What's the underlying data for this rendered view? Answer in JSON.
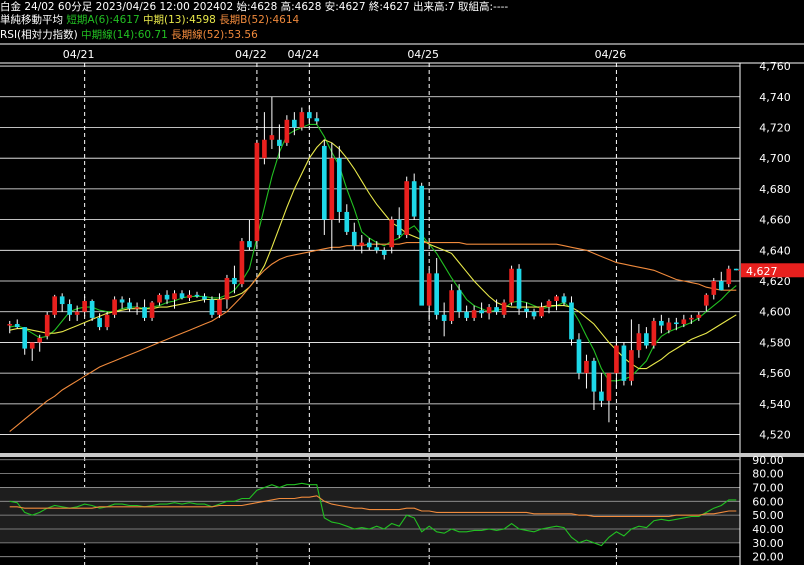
{
  "header": {
    "instrument": "白金 24/02 60分足 2023/04/26 12:00 202402",
    "open": "始:4628",
    "high": "高:4628",
    "low": "安:4627",
    "close": "終:4627",
    "volume": "出来高:7",
    "oi": "取組高:----",
    "ma_title": "単純移動平均",
    "ma_short": "短期A(6):4617",
    "ma_mid": "中期(13):4598",
    "ma_long": "長期B(52):4614",
    "rsi_title": "RSI(相対力指数)",
    "rsi_mid": "中期線(14):60.71",
    "rsi_long": "長期線(52):53.56"
  },
  "colors": {
    "up": "#e8201e",
    "down": "#1ed8e8",
    "ma_short": "#22c022",
    "ma_mid": "#e8e84a",
    "ma_long": "#f08a3c",
    "grid": "#ffffff",
    "price_tag": "#e8201e"
  },
  "chart_data": [
    {
      "type": "candlestick",
      "x_labels": [
        "04/21",
        "04/22",
        "04/24",
        "04/25",
        "04/26"
      ],
      "ylim": [
        4508,
        4762
      ],
      "y_ticks": [
        4520,
        4540,
        4560,
        4580,
        4600,
        4620,
        4640,
        4660,
        4680,
        4700,
        4720,
        4740,
        4760
      ],
      "y_tick_labels": [
        "4,520",
        "4,540",
        "4,560",
        "4,580",
        "4,600",
        "4,620",
        "4,640",
        "4,660",
        "4,680",
        "4,700",
        "4,720",
        "4,740",
        "4,760"
      ],
      "last_price": 4627,
      "last_price_label": "4,627",
      "candles": [
        [
          4591,
          4594,
          4586,
          4592
        ],
        [
          4592,
          4595,
          4589,
          4590
        ],
        [
          4590,
          4590,
          4572,
          4576
        ],
        [
          4576,
          4580,
          4568,
          4580
        ],
        [
          4580,
          4585,
          4574,
          4583
        ],
        [
          4584,
          4600,
          4582,
          4598
        ],
        [
          4598,
          4611,
          4596,
          4610
        ],
        [
          4610,
          4612,
          4600,
          4605
        ],
        [
          4605,
          4608,
          4594,
          4598
        ],
        [
          4598,
          4604,
          4594,
          4600
        ],
        [
          4600,
          4610,
          4597,
          4607
        ],
        [
          4607,
          4608,
          4594,
          4596
        ],
        [
          4596,
          4599,
          4588,
          4590
        ],
        [
          4590,
          4600,
          4588,
          4598
        ],
        [
          4598,
          4610,
          4596,
          4608
        ],
        [
          4608,
          4610,
          4602,
          4606
        ],
        [
          4606,
          4609,
          4600,
          4602
        ],
        [
          4602,
          4606,
          4598,
          4603
        ],
        [
          4603,
          4608,
          4594,
          4596
        ],
        [
          4596,
          4607,
          4594,
          4606
        ],
        [
          4606,
          4612,
          4604,
          4611
        ],
        [
          4611,
          4614,
          4605,
          4608
        ],
        [
          4608,
          4614,
          4602,
          4612
        ],
        [
          4612,
          4614,
          4608,
          4609
        ],
        [
          4609,
          4614,
          4607,
          4611
        ],
        [
          4611,
          4613,
          4609,
          4610
        ],
        [
          4610,
          4612,
          4606,
          4608
        ],
        [
          4608,
          4610,
          4596,
          4598
        ],
        [
          4598,
          4612,
          4596,
          4608
        ],
        [
          4608,
          4624,
          4602,
          4622
        ],
        [
          4622,
          4630,
          4612,
          4618
        ],
        [
          4618,
          4648,
          4616,
          4646
        ],
        [
          4646,
          4660,
          4640,
          4642
        ],
        [
          4646,
          4712,
          4642,
          4710
        ],
        [
          4700,
          4730,
          4696,
          4712
        ],
        [
          4712,
          4740,
          4706,
          4715
        ],
        [
          4712,
          4722,
          4700,
          4708
        ],
        [
          4710,
          4728,
          4708,
          4725
        ],
        [
          4725,
          4730,
          4715,
          4720
        ],
        [
          4720,
          4733,
          4718,
          4730
        ],
        [
          4730,
          4734,
          4722,
          4726
        ],
        [
          4726,
          4730,
          4722,
          4724
        ],
        [
          4708,
          4712,
          4650,
          4660
        ],
        [
          4660,
          4710,
          4640,
          4700
        ],
        [
          4700,
          4708,
          4658,
          4665
        ],
        [
          4665,
          4670,
          4650,
          4652
        ],
        [
          4652,
          4658,
          4640,
          4643
        ],
        [
          4643,
          4650,
          4638,
          4645
        ],
        [
          4645,
          4648,
          4640,
          4642
        ],
        [
          4642,
          4646,
          4638,
          4640
        ],
        [
          4640,
          4642,
          4634,
          4637
        ],
        [
          4642,
          4662,
          4638,
          4660
        ],
        [
          4660,
          4668,
          4648,
          4650
        ],
        [
          4650,
          4688,
          4648,
          4685
        ],
        [
          4685,
          4690,
          4660,
          4662
        ],
        [
          4682,
          4684,
          4640,
          4604
        ],
        [
          4604,
          4628,
          4594,
          4625
        ],
        [
          4625,
          4635,
          4595,
          4598
        ],
        [
          4598,
          4606,
          4584,
          4594
        ],
        [
          4594,
          4618,
          4592,
          4614
        ],
        [
          4614,
          4618,
          4596,
          4600
        ],
        [
          4600,
          4604,
          4594,
          4596
        ],
        [
          4596,
          4604,
          4594,
          4601
        ],
        [
          4601,
          4606,
          4596,
          4599
        ],
        [
          4599,
          4605,
          4595,
          4603
        ],
        [
          4603,
          4608,
          4598,
          4600
        ],
        [
          4598,
          4608,
          4596,
          4606
        ],
        [
          4606,
          4630,
          4604,
          4628
        ],
        [
          4628,
          4631,
          4598,
          4602
        ],
        [
          4602,
          4606,
          4596,
          4600
        ],
        [
          4600,
          4602,
          4595,
          4597
        ],
        [
          4597,
          4606,
          4596,
          4603
        ],
        [
          4603,
          4608,
          4599,
          4607
        ],
        [
          4607,
          4611,
          4601,
          4610
        ],
        [
          4610,
          4612,
          4604,
          4606
        ],
        [
          4606,
          4610,
          4578,
          4582
        ],
        [
          4582,
          4586,
          4556,
          4560
        ],
        [
          4560,
          4572,
          4550,
          4568
        ],
        [
          4568,
          4570,
          4536,
          4548
        ],
        [
          4548,
          4560,
          4538,
          4542
        ],
        [
          4542,
          4554,
          4528,
          4560
        ],
        [
          4560,
          4582,
          4550,
          4578
        ],
        [
          4578,
          4580,
          4552,
          4555
        ],
        [
          4555,
          4595,
          4552,
          4575
        ],
        [
          4575,
          4592,
          4570,
          4586
        ],
        [
          4586,
          4590,
          4576,
          4578
        ],
        [
          4578,
          4596,
          4576,
          4594
        ],
        [
          4594,
          4598,
          4586,
          4591
        ],
        [
          4588,
          4596,
          4586,
          4593
        ],
        [
          4593,
          4596,
          4588,
          4592
        ],
        [
          4592,
          4598,
          4590,
          4595
        ],
        [
          4595,
          4598,
          4592,
          4596
        ],
        [
          4596,
          4600,
          4594,
          4598
        ],
        [
          4604,
          4612,
          4600,
          4611
        ],
        [
          4611,
          4622,
          4608,
          4620
        ],
        [
          4620,
          4626,
          4614,
          4614
        ],
        [
          4618,
          4630,
          4616,
          4628
        ],
        [
          4628,
          4628,
          4627,
          4627
        ]
      ],
      "series": [
        {
          "name": "短期A(6)",
          "color": "#22c022",
          "values": [
            4590,
            4591,
            4589,
            4586,
            4583,
            4584,
            4588,
            4594,
            4600,
            4602,
            4603,
            4603,
            4601,
            4600,
            4600,
            4602,
            4603,
            4603,
            4602,
            4603,
            4604,
            4606,
            4607,
            4609,
            4610,
            4610,
            4610,
            4609,
            4609,
            4611,
            4614,
            4620,
            4628,
            4648,
            4668,
            4688,
            4704,
            4715,
            4718,
            4720,
            4722,
            4722,
            4714,
            4704,
            4695,
            4680,
            4667,
            4652,
            4648,
            4645,
            4643,
            4646,
            4648,
            4653,
            4656,
            4650,
            4644,
            4638,
            4630,
            4622,
            4615,
            4608,
            4604,
            4602,
            4600,
            4601,
            4602,
            4606,
            4607,
            4606,
            4604,
            4602,
            4603,
            4604,
            4606,
            4602,
            4594,
            4584,
            4575,
            4563,
            4555,
            4555,
            4556,
            4558,
            4563,
            4568,
            4578,
            4584,
            4587,
            4589,
            4591,
            4593,
            4596,
            4600,
            4604,
            4608,
            4613,
            4617
          ]
        },
        {
          "name": "中期(13)",
          "color": "#e8e84a",
          "values": [
            4588,
            4589,
            4589,
            4588,
            4587,
            4586,
            4586,
            4587,
            4589,
            4591,
            4593,
            4595,
            4597,
            4599,
            4600,
            4601,
            4602,
            4602,
            4602,
            4602,
            4603,
            4603,
            4604,
            4605,
            4606,
            4607,
            4608,
            4608,
            4608,
            4609,
            4610,
            4612,
            4616,
            4622,
            4630,
            4642,
            4655,
            4668,
            4680,
            4690,
            4700,
            4707,
            4712,
            4710,
            4706,
            4700,
            4693,
            4685,
            4677,
            4670,
            4664,
            4658,
            4655,
            4651,
            4649,
            4647,
            4644,
            4642,
            4640,
            4638,
            4632,
            4626,
            4620,
            4615,
            4610,
            4606,
            4604,
            4603,
            4603,
            4603,
            4603,
            4603,
            4604,
            4604,
            4604,
            4603,
            4600,
            4596,
            4592,
            4586,
            4580,
            4575,
            4570,
            4566,
            4563,
            4563,
            4566,
            4569,
            4573,
            4576,
            4579,
            4582,
            4584,
            4586,
            4589,
            4592,
            4595,
            4598
          ]
        },
        {
          "name": "長期B(52)",
          "color": "#f08a3c",
          "values": [
            4522,
            4526,
            4530,
            4534,
            4538,
            4542,
            4545,
            4549,
            4552,
            4555,
            4558,
            4561,
            4564,
            4566,
            4568,
            4570,
            4572,
            4574,
            4576,
            4578,
            4580,
            4582,
            4584,
            4586,
            4588,
            4590,
            4592,
            4594,
            4597,
            4600,
            4605,
            4610,
            4616,
            4622,
            4627,
            4631,
            4634,
            4636,
            4637,
            4638,
            4639,
            4640,
            4641,
            4642,
            4642,
            4643,
            4643,
            4643,
            4644,
            4644,
            4644,
            4644,
            4644,
            4645,
            4645,
            4645,
            4645,
            4645,
            4645,
            4645,
            4645,
            4644,
            4644,
            4644,
            4644,
            4644,
            4644,
            4644,
            4644,
            4644,
            4644,
            4644,
            4644,
            4644,
            4643,
            4642,
            4641,
            4640,
            4638,
            4636,
            4634,
            4632,
            4631,
            4630,
            4629,
            4628,
            4627,
            4625,
            4623,
            4621,
            4620,
            4619,
            4618,
            4616,
            4615,
            4614,
            4614,
            4614
          ]
        }
      ]
    },
    {
      "type": "line",
      "title": "RSI(相対力指数)",
      "ylim": [
        14,
        92
      ],
      "y_ticks": [
        20,
        30,
        40,
        50,
        60,
        70,
        80,
        90
      ],
      "y_tick_labels": [
        "20.00",
        "30.00",
        "40.00",
        "50.00",
        "60.00",
        "70.00",
        "80.00",
        "90.00"
      ],
      "series": [
        {
          "name": "中期線(14)",
          "color": "#22c022",
          "values": [
            60,
            59,
            52,
            50,
            52,
            55,
            57,
            56,
            55,
            56,
            58,
            57,
            55,
            56,
            58,
            58,
            57,
            57,
            56,
            57,
            58,
            58,
            59,
            58,
            59,
            58,
            58,
            56,
            58,
            60,
            60,
            62,
            62,
            68,
            70,
            72,
            70,
            72,
            72,
            73,
            72,
            72,
            48,
            45,
            44,
            42,
            40,
            41,
            40,
            42,
            40,
            44,
            42,
            50,
            48,
            38,
            42,
            38,
            37,
            40,
            38,
            38,
            39,
            39,
            40,
            39,
            40,
            44,
            40,
            39,
            38,
            40,
            41,
            42,
            41,
            34,
            30,
            32,
            30,
            28,
            34,
            38,
            35,
            40,
            42,
            41,
            46,
            47,
            46,
            47,
            48,
            49,
            49,
            52,
            55,
            57,
            61,
            61
          ]
        },
        {
          "name": "長期線(52)",
          "color": "#f08a3c",
          "values": [
            56,
            56,
            55,
            55,
            55,
            55,
            55,
            55,
            55,
            55,
            55,
            55,
            56,
            56,
            56,
            56,
            56,
            56,
            56,
            56,
            56,
            56,
            56,
            56,
            56,
            56,
            56,
            56,
            57,
            57,
            57,
            57,
            58,
            59,
            60,
            61,
            62,
            62,
            62,
            63,
            63,
            64,
            60,
            58,
            57,
            56,
            55,
            55,
            54,
            54,
            54,
            54,
            54,
            55,
            55,
            53,
            53,
            52,
            52,
            52,
            52,
            52,
            52,
            52,
            52,
            52,
            52,
            52,
            52,
            52,
            51,
            51,
            51,
            51,
            51,
            51,
            50,
            50,
            49,
            49,
            49,
            49,
            49,
            49,
            49,
            49,
            49,
            49,
            49,
            50,
            50,
            50,
            50,
            51,
            51,
            52,
            53,
            53
          ]
        }
      ]
    }
  ]
}
